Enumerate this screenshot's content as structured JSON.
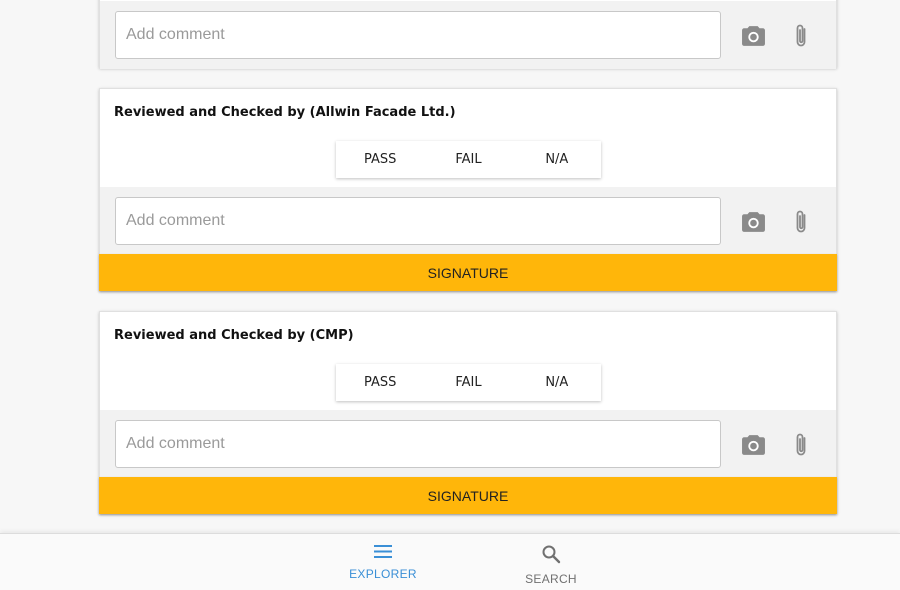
{
  "cards": [
    {
      "comment_placeholder": "Add comment"
    },
    {
      "title": "Reviewed and Checked by (Allwin Facade Ltd.)",
      "options": [
        "PASS",
        "FAIL",
        "N/A"
      ],
      "comment_placeholder": "Add comment",
      "signature_label": "SIGNATURE"
    },
    {
      "title": "Reviewed and Checked by (CMP)",
      "options": [
        "PASS",
        "FAIL",
        "N/A"
      ],
      "comment_placeholder": "Add comment",
      "signature_label": "SIGNATURE"
    }
  ],
  "icons": {
    "camera": "camera-icon",
    "attach": "paperclip-icon",
    "explorer": "menu-icon",
    "search": "search-icon"
  },
  "bottom_nav": {
    "items": [
      {
        "label": "EXPLORER",
        "active": true
      },
      {
        "label": "SEARCH",
        "active": false
      }
    ]
  },
  "colors": {
    "accent": "#ffb60a",
    "nav_active": "#3a8fd6",
    "nav_inactive": "#707070",
    "icon": "#8a8a8a"
  }
}
